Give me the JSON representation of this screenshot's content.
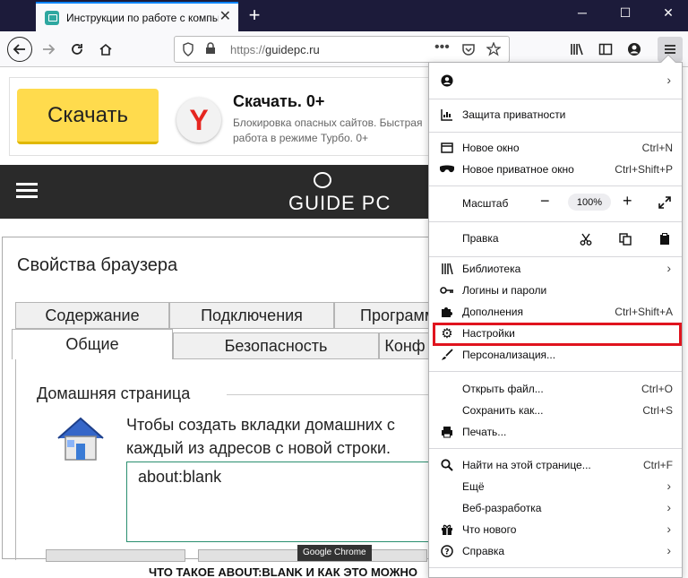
{
  "browser": {
    "tab_title": "Инструкции по работе с компьютером",
    "url_scheme": "https://",
    "url_host": "guidepc.ru",
    "newtab_symbol": "+",
    "tab_close_symbol": "✕",
    "win_minimize": "─",
    "win_maximize": "☐",
    "win_close": "✕"
  },
  "ad": {
    "button_label": "Скачать",
    "title": "Скачать. 0+",
    "description": "Блокировка опасных сайтов. Быстрая работа в режиме Турбо. 0+",
    "logo_letter": "Y"
  },
  "site": {
    "logo_text": "GUIDE PC"
  },
  "dialog": {
    "title": "Свойства браузера",
    "tabs_back": [
      "Содержание",
      "Подключения",
      "Программы"
    ],
    "tabs_front": [
      "Общие",
      "Безопасность",
      "Конф"
    ],
    "section_label": "Домашняя страница",
    "home_text_line1": "Чтобы создать вкладки домашних с",
    "home_text_line2": "каждый из адресов с новой строки.",
    "home_value": "about:blank"
  },
  "tooltip": "Google Chrome",
  "footer_text": "ЧТО ТАКОЕ ABOUT:BLANK И КАК ЭТО МОЖНО",
  "menu": {
    "account_arrow": "›",
    "privacy": "Защита приватности",
    "new_window": "Новое окно",
    "new_window_short": "Ctrl+N",
    "private_window": "Новое приватное окно",
    "private_window_short": "Ctrl+Shift+P",
    "zoom_label": "Масштаб",
    "zoom_value": "100%",
    "edit_label": "Правка",
    "library": "Библиотека",
    "logins": "Логины и пароли",
    "addons": "Дополнения",
    "addons_short": "Ctrl+Shift+A",
    "settings": "Настройки",
    "customize": "Персонализация...",
    "open_file": "Открыть файл...",
    "open_file_short": "Ctrl+O",
    "save_as": "Сохранить как...",
    "save_as_short": "Ctrl+S",
    "print": "Печать...",
    "find": "Найти на этой странице...",
    "find_short": "Ctrl+F",
    "more": "Ещё",
    "web_dev": "Веб-разработка",
    "whats_new": "Что нового",
    "help": "Справка"
  }
}
